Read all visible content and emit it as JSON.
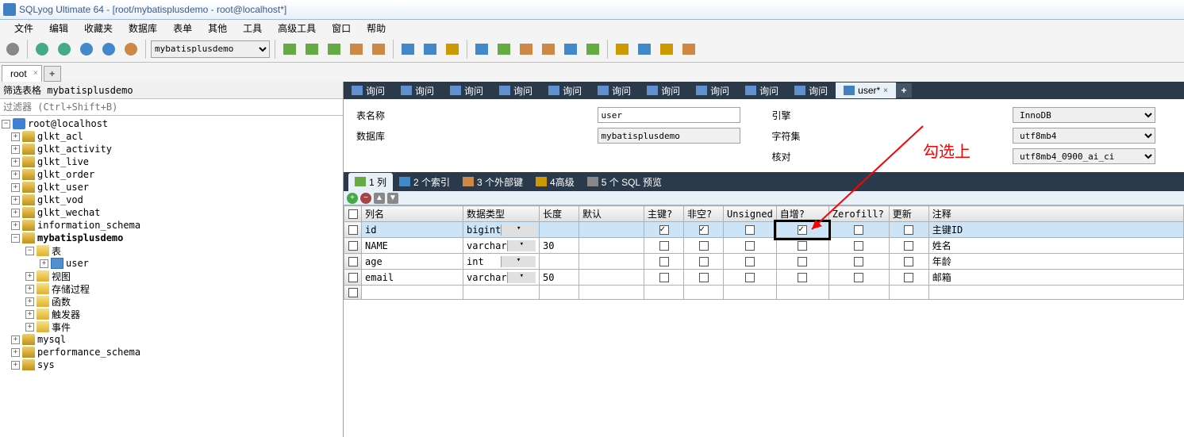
{
  "title": "SQLyog Ultimate 64 - [root/mybatisplusdemo - root@localhost*]",
  "menus": [
    "文件",
    "编辑",
    "收藏夹",
    "数据库",
    "表单",
    "其他",
    "工具",
    "高级工具",
    "窗口",
    "帮助"
  ],
  "dbSelector": "mybatisplusdemo",
  "connTab": "root",
  "sidebar": {
    "filterHeader": "筛选表格 mybatisplusdemo",
    "filterPlaceholder": "过滤器 (Ctrl+Shift+B)",
    "root": "root@localhost",
    "dbs": [
      "glkt_acl",
      "glkt_activity",
      "glkt_live",
      "glkt_order",
      "glkt_user",
      "glkt_vod",
      "glkt_wechat",
      "information_schema"
    ],
    "currentDb": "mybatisplusdemo",
    "folders": {
      "table": "表",
      "view": "视图",
      "proc": "存储过程",
      "func": "函数",
      "trigger": "触发器",
      "event": "事件"
    },
    "userTable": "user",
    "dbs2": [
      "mysql",
      "performance_schema",
      "sys"
    ]
  },
  "queryTabs": {
    "label": "询问",
    "active": "user*"
  },
  "form": {
    "tableNameLabel": "表名称",
    "tableName": "user",
    "engineLabel": "引擎",
    "engine": "InnoDB",
    "databaseLabel": "数据库",
    "database": "mybatisplusdemo",
    "charsetLabel": "字符集",
    "charset": "utf8mb4",
    "collationLabel": "核对",
    "collation": "utf8mb4_0900_ai_ci"
  },
  "subtabs": {
    "cols": "1 列",
    "idx": "2 个索引",
    "fk": "3 个外部键",
    "adv": "4高级",
    "sql": "5 个 SQL 预览"
  },
  "gridHeaders": {
    "name": "列名",
    "type": "数据类型",
    "len": "长度",
    "default": "默认",
    "pk": "主键?",
    "nn": "非空?",
    "unsigned": "Unsigned",
    "ai": "自增?",
    "zf": "Zerofill?",
    "upd": "更新",
    "comment": "注释"
  },
  "rows": [
    {
      "name": "id",
      "type": "bigint",
      "len": "",
      "pk": true,
      "nn": true,
      "ai": true,
      "comment": "主键ID",
      "sel": true
    },
    {
      "name": "NAME",
      "type": "varchar",
      "len": "30",
      "pk": false,
      "nn": false,
      "ai": false,
      "comment": "姓名"
    },
    {
      "name": "age",
      "type": "int",
      "len": "",
      "pk": false,
      "nn": false,
      "ai": false,
      "comment": "年龄"
    },
    {
      "name": "email",
      "type": "varchar",
      "len": "50",
      "pk": false,
      "nn": false,
      "ai": false,
      "comment": "邮箱"
    }
  ],
  "annotation": "勾选上"
}
